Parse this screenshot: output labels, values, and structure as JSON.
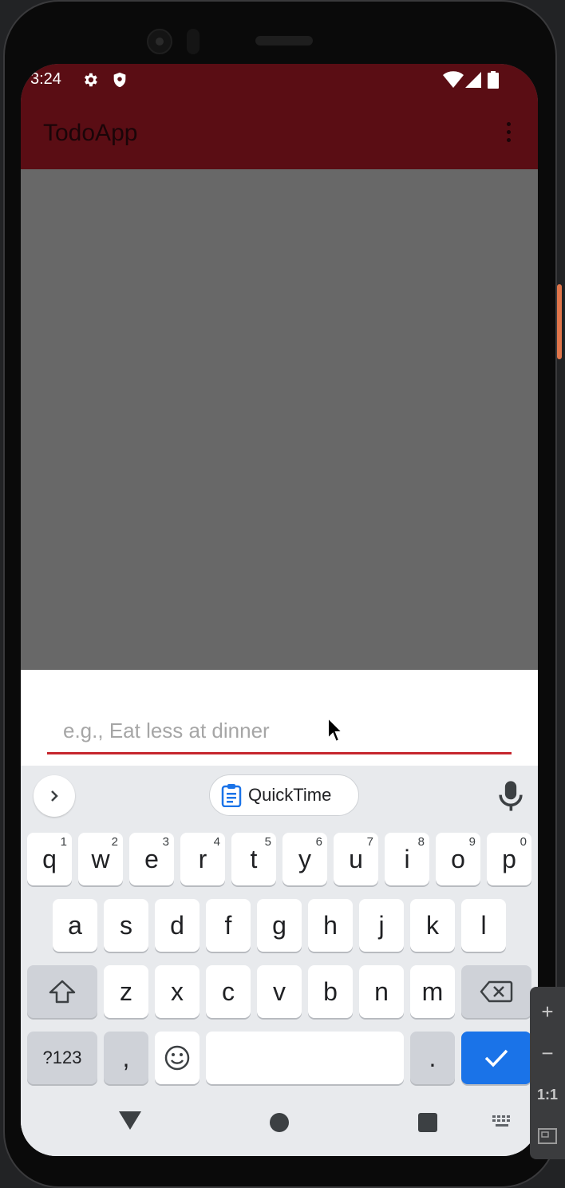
{
  "status_bar": {
    "time": "3:24",
    "icons": [
      "gear-icon",
      "shield-icon",
      "wifi-icon",
      "signal-icon",
      "battery-icon"
    ]
  },
  "app_bar": {
    "title": "TodoApp",
    "menu_icon": "overflow-menu-icon"
  },
  "todo_input": {
    "value": "",
    "placeholder": "e.g., Eat less at dinner"
  },
  "keyboard": {
    "clipboard_chip": "QuickTime",
    "row1": [
      {
        "key": "q",
        "hint": "1"
      },
      {
        "key": "w",
        "hint": "2"
      },
      {
        "key": "e",
        "hint": "3"
      },
      {
        "key": "r",
        "hint": "4"
      },
      {
        "key": "t",
        "hint": "5"
      },
      {
        "key": "y",
        "hint": "6"
      },
      {
        "key": "u",
        "hint": "7"
      },
      {
        "key": "i",
        "hint": "8"
      },
      {
        "key": "o",
        "hint": "9"
      },
      {
        "key": "p",
        "hint": "0"
      }
    ],
    "row2": [
      "a",
      "s",
      "d",
      "f",
      "g",
      "h",
      "j",
      "k",
      "l"
    ],
    "row3": [
      "z",
      "x",
      "c",
      "v",
      "b",
      "n",
      "m"
    ],
    "symbols_key": "?123",
    "comma_key": ",",
    "period_key": "."
  },
  "emulator_toolbar": {
    "zoom_in": "+",
    "zoom_out": "−",
    "one_to_one": "1:1"
  },
  "colors": {
    "app_bar": "#5a0d14",
    "accent_underline": "#c6262e",
    "enter_key": "#1a73e8"
  }
}
